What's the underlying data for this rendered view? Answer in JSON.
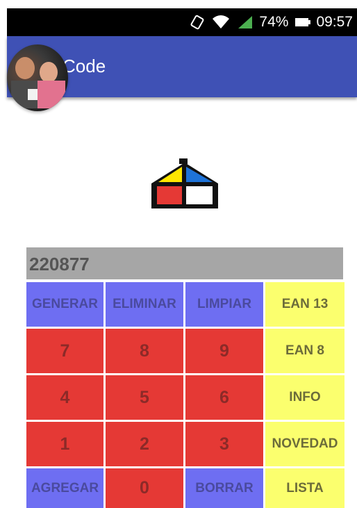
{
  "status_bar": {
    "battery": "74%",
    "time": "09:57"
  },
  "app_bar": {
    "title": "Code"
  },
  "display": {
    "value": "220877"
  },
  "keypad": {
    "generar": "GENERAR",
    "eliminar": "ELIMINAR",
    "limpiar": "LIMPIAR",
    "ean13": "EAN 13",
    "k7": "7",
    "k8": "8",
    "k9": "9",
    "ean8": "EAN 8",
    "k4": "4",
    "k5": "5",
    "k6": "6",
    "info": "INFO",
    "k1": "1",
    "k2": "2",
    "k3": "3",
    "novedad": "NOVEDAD",
    "agregar": "AGREGAR",
    "k0": "0",
    "borrar": "BORRAR",
    "lista": "LISTA"
  },
  "colors": {
    "app_bar": "#3f51b5",
    "key_blue": "#6e6ef2",
    "key_red": "#e53935",
    "key_yellow": "#fbff6e",
    "display": "#a6a6a6"
  }
}
